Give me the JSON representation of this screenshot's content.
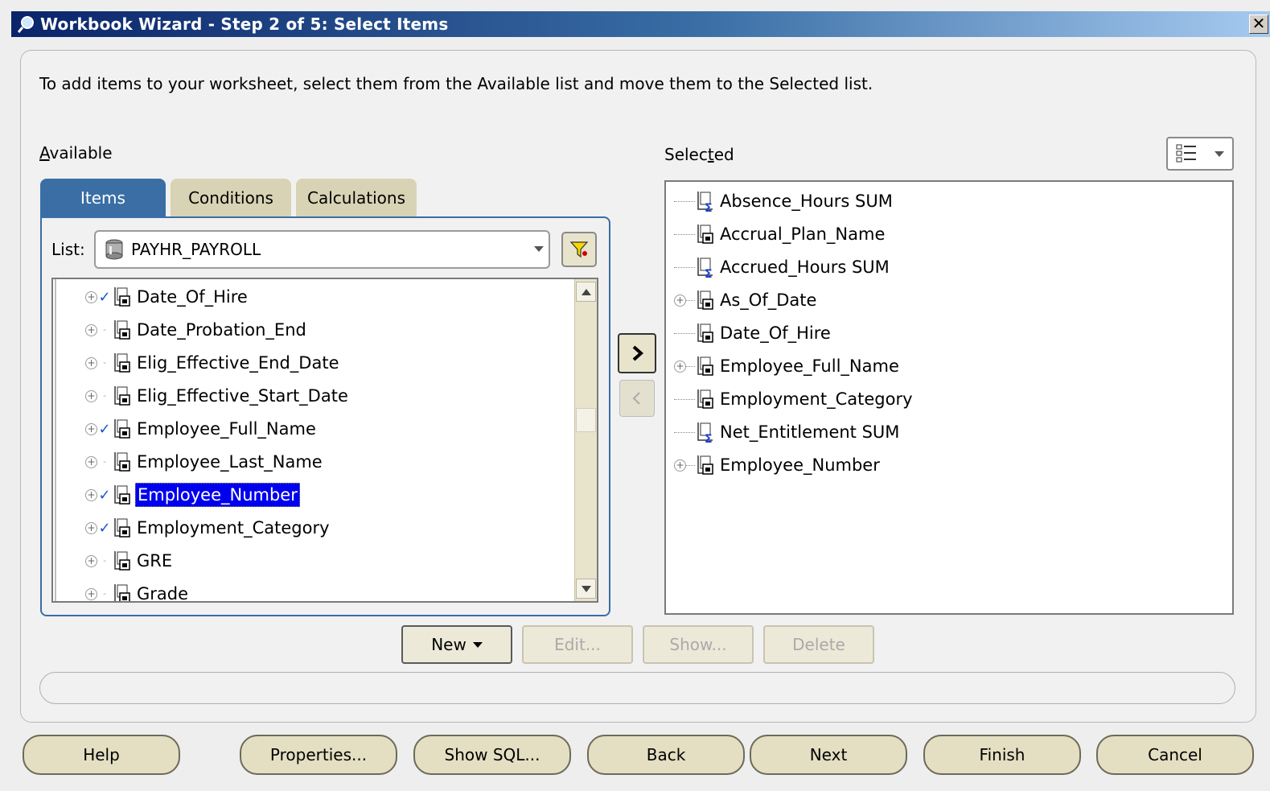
{
  "window": {
    "title": "Workbook Wizard - Step 2 of 5: Select Items",
    "close_label": "✕"
  },
  "instructions": "To add items to your worksheet, select them from the Available list and move them to the Selected list.",
  "available": {
    "label": "Available",
    "tabs": [
      {
        "label": "Items",
        "active": true
      },
      {
        "label": "Conditions",
        "active": false
      },
      {
        "label": "Calculations",
        "active": false
      }
    ],
    "list_label": "List:",
    "list_value": "PAYHR_PAYROLL",
    "items": [
      {
        "label": "Date_Of_Hire",
        "checked": true,
        "selected": false
      },
      {
        "label": "Date_Probation_End",
        "checked": false,
        "selected": false
      },
      {
        "label": "Elig_Effective_End_Date",
        "checked": false,
        "selected": false
      },
      {
        "label": "Elig_Effective_Start_Date",
        "checked": false,
        "selected": false
      },
      {
        "label": "Employee_Full_Name",
        "checked": true,
        "selected": false
      },
      {
        "label": "Employee_Last_Name",
        "checked": false,
        "selected": false
      },
      {
        "label": "Employee_Number",
        "checked": true,
        "selected": true
      },
      {
        "label": "Employment_Category",
        "checked": true,
        "selected": false
      },
      {
        "label": "GRE",
        "checked": false,
        "selected": false
      },
      {
        "label": "Grade",
        "checked": false,
        "selected": false
      }
    ]
  },
  "selected": {
    "label": "Selected",
    "items": [
      {
        "label": "Absence_Hours SUM",
        "kind": "sum",
        "expandable": false
      },
      {
        "label": "Accrual_Plan_Name",
        "kind": "item",
        "expandable": false
      },
      {
        "label": "Accrued_Hours SUM",
        "kind": "sum",
        "expandable": false
      },
      {
        "label": "As_Of_Date",
        "kind": "item",
        "expandable": true
      },
      {
        "label": "Date_Of_Hire",
        "kind": "item",
        "expandable": false
      },
      {
        "label": "Employee_Full_Name",
        "kind": "item",
        "expandable": true
      },
      {
        "label": "Employment_Category",
        "kind": "item",
        "expandable": false
      },
      {
        "label": "Net_Entitlement SUM",
        "kind": "sum",
        "expandable": false
      },
      {
        "label": "Employee_Number",
        "kind": "item",
        "expandable": true
      }
    ]
  },
  "action_buttons": {
    "new": "New",
    "edit": "Edit...",
    "show": "Show...",
    "delete": "Delete"
  },
  "footer": {
    "help": "Help",
    "properties": "Properties...",
    "show_sql": "Show SQL...",
    "back": "Back",
    "next": "Next",
    "finish": "Finish",
    "cancel": "Cancel"
  },
  "colors": {
    "title_bar": "#0a246a",
    "active_tab": "#3a6ea5",
    "inactive_tab": "#d8d3b4",
    "selection": "#0000ee",
    "button_face": "#e4dfc2"
  },
  "icons": [
    "discoverer-logo-icon",
    "close-icon",
    "database-icon",
    "filter-icon",
    "item-icon",
    "sum-item-icon",
    "check-icon",
    "expand-icon",
    "move-right-icon",
    "move-left-icon",
    "list-view-icon",
    "scroll-up-icon",
    "scroll-down-icon"
  ]
}
